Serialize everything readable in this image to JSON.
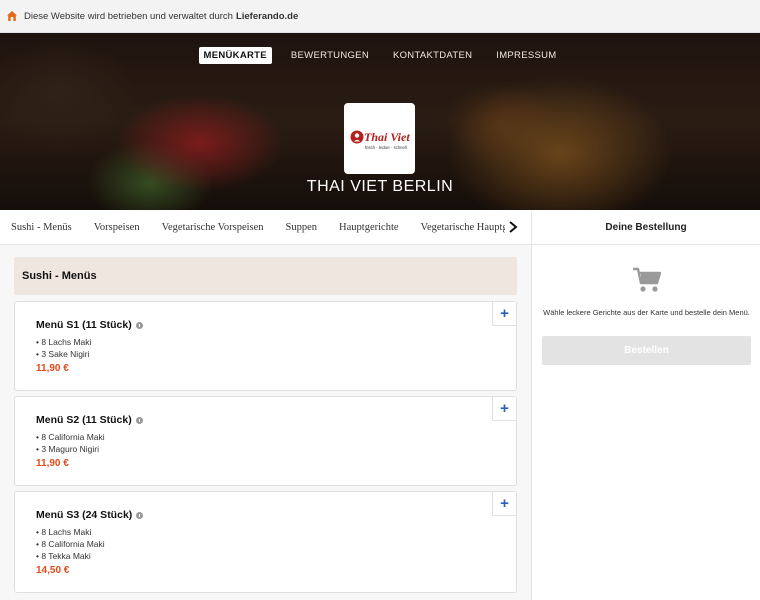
{
  "topbar": {
    "text": "Diese Website wird betrieben und verwaltet durch",
    "brand": "Lieferando.de"
  },
  "nav": {
    "items": [
      "MENÜKARTE",
      "BEWERTUNGEN",
      "KONTAKTDATEN",
      "IMPRESSUM"
    ],
    "active": 0
  },
  "logo": {
    "name": "Thai Viet",
    "tagline": "frisch · lecker · schnell"
  },
  "restaurant": {
    "name": "THAI VIET BERLIN"
  },
  "categories": [
    "Sushi - Menüs",
    "Vorspeisen",
    "Vegetarische Vorspeisen",
    "Suppen",
    "Hauptgerichte",
    "Vegetarische Hauptge"
  ],
  "section": {
    "title": "Sushi - Menüs"
  },
  "items": [
    {
      "title": "Menü S1 (11 Stück)",
      "lines": [
        "• 8 Lachs Maki",
        "• 3 Sake Nigiri"
      ],
      "price": "11,90 €"
    },
    {
      "title": "Menü S2 (11 Stück)",
      "lines": [
        "• 8 California Maki",
        "• 3 Maguro Nigiri"
      ],
      "price": "11,90 €"
    },
    {
      "title": "Menü S3 (24 Stück)",
      "lines": [
        "• 8 Lachs Maki",
        "• 8 California Maki",
        "• 8 Tekka Maki"
      ],
      "price": "14,50 €"
    }
  ],
  "plus_label": "+",
  "sidebar": {
    "title": "Deine Bestellung",
    "empty_text": "Wähle leckere Gerichte aus der Karte und bestelle dein Menü.",
    "order_button": "Bestellen"
  },
  "colors": {
    "price": "#e64a19",
    "accent_blue": "#2b5fbf",
    "section_bg": "#efe6df",
    "logo_red": "#b3201e"
  }
}
